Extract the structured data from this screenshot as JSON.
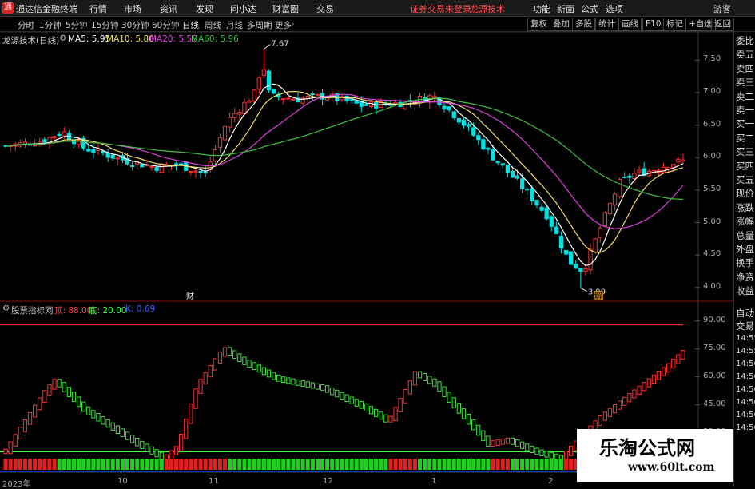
{
  "app": {
    "title": "通达信金融终端"
  },
  "menu": [
    "行情",
    "市场",
    "资讯",
    "发现",
    "问小达",
    "财富圈",
    "交易"
  ],
  "notice": {
    "trade": "证券交易未登录",
    "brand": "龙源技术"
  },
  "right_menu": [
    "功能",
    "新面",
    "公式",
    "选项"
  ],
  "guest_label": "游客",
  "periods": [
    "分时",
    "1分钟",
    "5分钟",
    "15分钟",
    "30分钟",
    "60分钟",
    "日线",
    "周线",
    "月线",
    "多周期",
    "更多"
  ],
  "period_active": "日线",
  "toolbar_right": [
    "复权",
    "叠加",
    "多股",
    "统计",
    "画线",
    "F10",
    "标记",
    "+自选",
    "返回"
  ],
  "main_chart": {
    "name": "龙源技术(日线)",
    "ma": [
      {
        "label": "MA5: 5.95",
        "color": "#ffffff"
      },
      {
        "label": "MA10: 5.80",
        "color": "#f0e060"
      },
      {
        "label": "MA20: 5.58",
        "color": "#e040e0"
      },
      {
        "label": "MA60: 5.96",
        "color": "#40c040"
      }
    ],
    "high_label": "7.67",
    "low_label": "3.99",
    "marker_cai": "财",
    "marker_jie": "解",
    "y_ticks": [
      "7.50",
      "7.00",
      "6.50",
      "6.00",
      "5.50",
      "5.00",
      "4.50",
      "4.00"
    ]
  },
  "sub_chart": {
    "name": "股票指标网",
    "legend": [
      {
        "label": "顶: 88.00",
        "color": "#ff4040"
      },
      {
        "label": "底: 20.00",
        "color": "#40ff40"
      },
      {
        "label": "K: 0.69",
        "color": "#4060ff"
      }
    ],
    "y_ticks": [
      "90.00",
      "75.00",
      "60.00",
      "45.00",
      "30.00"
    ]
  },
  "x_dates": [
    "2023年",
    "10",
    "11",
    "12",
    "1",
    "2"
  ],
  "right_panel": [
    "委比",
    "卖五",
    "卖四",
    "卖三",
    "卖二",
    "卖一",
    "买一",
    "买二",
    "买三",
    "买四",
    "买五",
    "现价",
    "涨跌",
    "涨幅",
    "总量",
    "外盘",
    "换手",
    "净资",
    "收益"
  ],
  "right_panel_lower": [
    "自动",
    "交易",
    "14:55",
    "14:55",
    "14:56",
    "14:56",
    "14:56",
    "14:56",
    "14:56",
    "14:56"
  ],
  "watermark": {
    "line1": "乐淘公式网",
    "line2": "www.60lt.com"
  },
  "colors": {
    "up": "#ff3030",
    "down": "#00e0e0",
    "ma5": "#ffffff",
    "ma10": "#f0e060",
    "ma20": "#e040e0",
    "ma60": "#40c040"
  }
}
